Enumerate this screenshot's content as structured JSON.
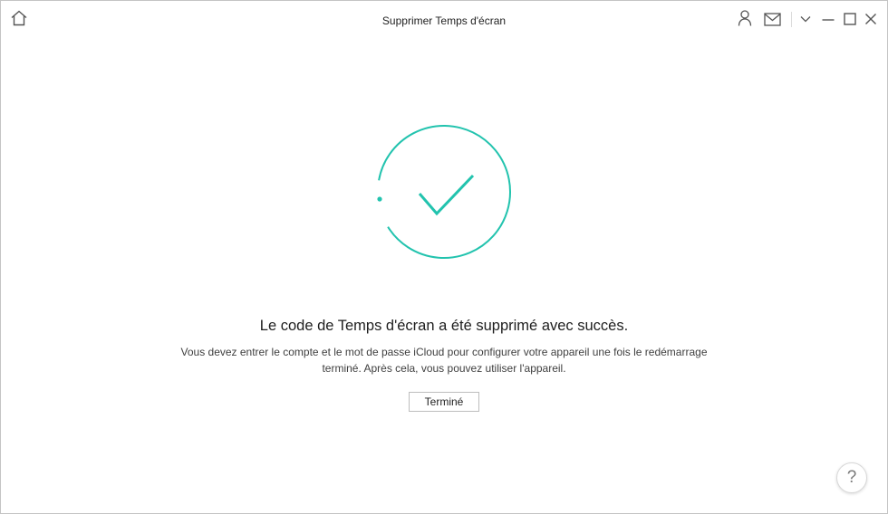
{
  "window": {
    "title": "Supprimer Temps d'écran"
  },
  "titlebar": {
    "left_icons": [
      "home-icon"
    ],
    "right_icons": [
      "user-icon",
      "mail-icon",
      "chevron-down-icon",
      "minimize-icon",
      "maximize-icon",
      "close-icon"
    ]
  },
  "result": {
    "status_icon": "success-check-icon",
    "heading": "Le code de Temps d'écran a été supprimé avec succès.",
    "description": [
      "Vous devez entrer le compte et le mot de passe iCloud pour configurer votre appareil une fois le redémarrage",
      "terminé. Après cela, vous pouvez utiliser l'appareil."
    ],
    "done_button": "Terminé"
  },
  "help": {
    "icon": "help-icon",
    "label": "?"
  },
  "colors": {
    "accent": "#22c3ae",
    "text": "#222222",
    "icon": "#555555",
    "border": "#c4c4c4"
  }
}
